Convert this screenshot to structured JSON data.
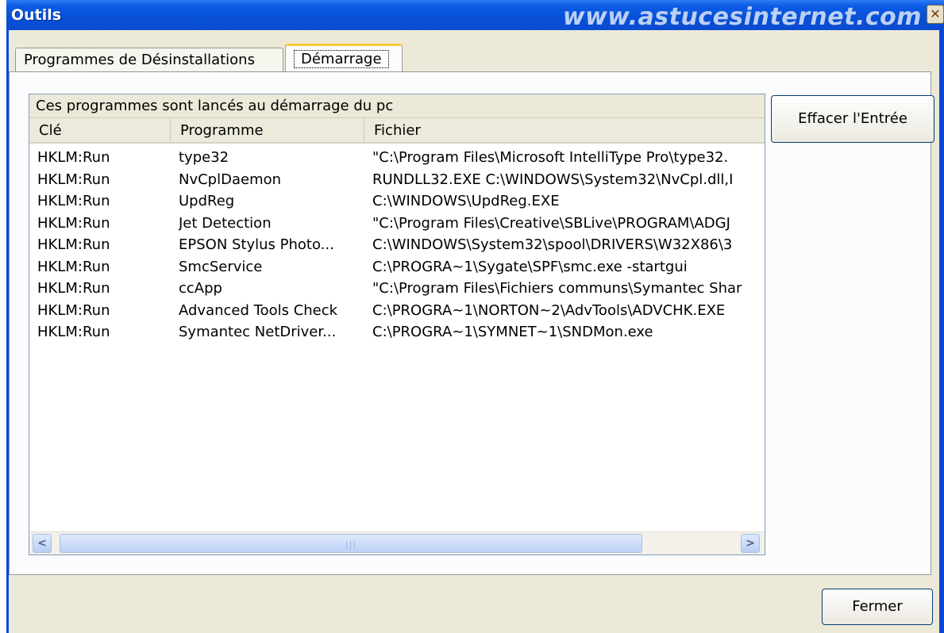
{
  "window": {
    "title": "Outils",
    "watermark": "www.astucesinternet.com",
    "close_symbol": "✕"
  },
  "tabs": [
    {
      "label": "Programmes de Désinstallations",
      "active": false
    },
    {
      "label": "Démarrage",
      "active": true
    }
  ],
  "group_header": "Ces programmes sont lancés au démarrage du pc",
  "columns": [
    "Clé",
    "Programme",
    "Fichier"
  ],
  "rows": [
    {
      "key": "HKLM:Run",
      "program": "type32",
      "file": "\"C:\\Program Files\\Microsoft IntelliType Pro\\type32."
    },
    {
      "key": "HKLM:Run",
      "program": "NvCplDaemon",
      "file": "RUNDLL32.EXE C:\\WINDOWS\\System32\\NvCpl.dll,I"
    },
    {
      "key": "HKLM:Run",
      "program": "UpdReg",
      "file": "C:\\WINDOWS\\UpdReg.EXE"
    },
    {
      "key": "HKLM:Run",
      "program": "Jet Detection",
      "file": "\"C:\\Program Files\\Creative\\SBLive\\PROGRAM\\ADGJ"
    },
    {
      "key": "HKLM:Run",
      "program": "EPSON Stylus Photo...",
      "file": "C:\\WINDOWS\\System32\\spool\\DRIVERS\\W32X86\\3"
    },
    {
      "key": "HKLM:Run",
      "program": "SmcService",
      "file": "C:\\PROGRA~1\\Sygate\\SPF\\smc.exe -startgui"
    },
    {
      "key": "HKLM:Run",
      "program": "ccApp",
      "file": "\"C:\\Program Files\\Fichiers communs\\Symantec Shar"
    },
    {
      "key": "HKLM:Run",
      "program": "Advanced Tools Check",
      "file": "C:\\PROGRA~1\\NORTON~2\\AdvTools\\ADVCHK.EXE"
    },
    {
      "key": "HKLM:Run",
      "program": "Symantec NetDriver...",
      "file": "C:\\PROGRA~1\\SYMNET~1\\SNDMon.exe"
    }
  ],
  "scrollbar": {
    "left_arrow": "<",
    "right_arrow": ">",
    "grip": "|||"
  },
  "buttons": {
    "clear_entry": "Effacer l'Entrée",
    "close": "Fermer"
  },
  "colors": {
    "titlebar": "#0850d6",
    "dialog_bg": "#ece9d8",
    "active_tab_highlight": "#ffc83c"
  }
}
